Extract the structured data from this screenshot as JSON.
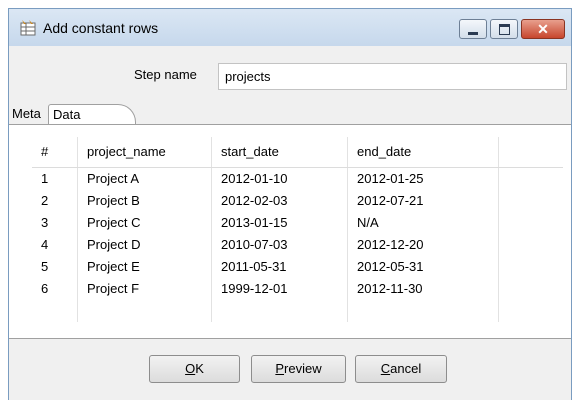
{
  "window": {
    "title": "Add constant rows",
    "close_glyph": "✕"
  },
  "step": {
    "label": "Step name",
    "value": "projects"
  },
  "tabs": [
    {
      "label": "Meta"
    },
    {
      "label": "Data"
    }
  ],
  "table": {
    "columns": [
      "#",
      "project_name",
      "start_date",
      "end_date",
      ""
    ],
    "rows": [
      [
        "1",
        "Project A",
        "2012-01-10",
        "2012-01-25",
        ""
      ],
      [
        "2",
        "Project B",
        "2012-02-03",
        "2012-07-21",
        ""
      ],
      [
        "3",
        "Project C",
        "2013-01-15",
        "N/A",
        ""
      ],
      [
        "4",
        "Project D",
        "2010-07-03",
        "2012-12-20",
        ""
      ],
      [
        "5",
        "Project E",
        "2011-05-31",
        "2012-05-31",
        ""
      ],
      [
        "6",
        "Project F",
        "1999-12-01",
        "2012-11-30",
        ""
      ],
      [
        "",
        "",
        "",
        "",
        ""
      ]
    ]
  },
  "buttons": {
    "ok": {
      "mnemonic": "O",
      "rest": "K"
    },
    "preview": {
      "mnemonic": "P",
      "rest": "review"
    },
    "cancel": {
      "mnemonic": "C",
      "rest": "ancel"
    }
  },
  "icons": {
    "app": "table-icon"
  },
  "colors": {
    "title_bar": "#c6d8ec",
    "close_button": "#c7462d",
    "window_border": "#7a9cc0"
  }
}
